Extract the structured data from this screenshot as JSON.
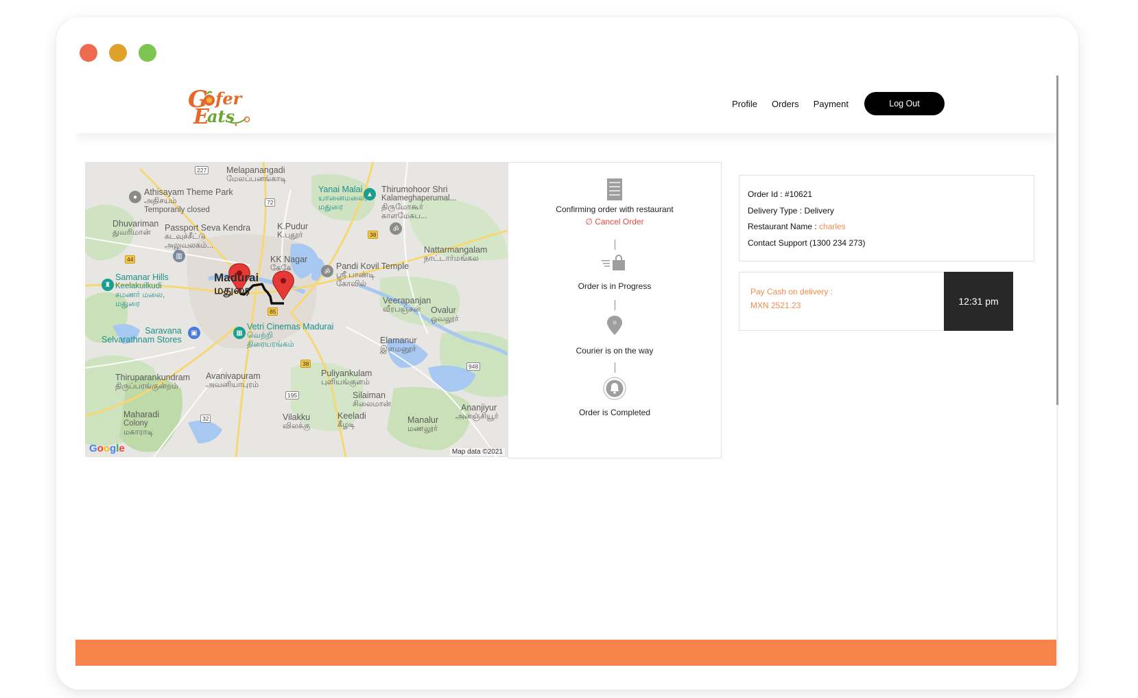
{
  "window": {
    "controls": [
      {
        "name": "close",
        "color": "#ee6a50"
      },
      {
        "name": "minimize",
        "color": "#e0a12a"
      },
      {
        "name": "maximize",
        "color": "#7dc453"
      }
    ]
  },
  "brand": {
    "logo_line1": "Gofer",
    "logo_line2": "Eats",
    "accent_color": "#f5834a",
    "logo_orange": "#e5682a",
    "logo_green": "#6aa632"
  },
  "nav": {
    "links": [
      "Profile",
      "Orders",
      "Payment"
    ],
    "logout_label": "Log Out"
  },
  "map": {
    "labels": {
      "melapanangadi": "Melapanangadi",
      "melapanangadi_ta": "மேலப்பனங்காடி",
      "athisayam": "Athisayam Theme Park",
      "athisayam_ta": "அதிசயம்",
      "athisayam_note": "Temporarily closed",
      "yanai_malai": "Yanai Malai",
      "yanai_malai_ta": "யானைமலை,",
      "yanai_malai_ta2": "மதுரை",
      "thirumohoor": "Thirumohoor Shri",
      "thirumohoor2": "Kalameghaperumal...",
      "thirumohoor_ta": "திருமோகூர்",
      "thirumohoor_ta2": "காளமேகப...",
      "dhuvariman": "Dhuvariman",
      "dhuvariman_ta": "துவரிமான்",
      "passport": "Passport Seva Kendra",
      "passport_ta": "கடவுச்சீட்டு",
      "passport_ta2": "அலுவலகம்...",
      "kpudur": "K.Pudur",
      "kpudur_ta": "K.புதூர்",
      "kknagar": "KK Nagar",
      "kknagar_ta": "கேகே",
      "nattarmangalam": "Nattarmangalam",
      "nattarmangalam_ta": "நாட்டார்மங்கல",
      "samanar": "Samanar Hills",
      "samanar2": "Keelakuilkudi",
      "samanar_ta": "சமணர் மலை,",
      "samanar_ta2": "மதுரை",
      "madurai": "Madurai",
      "madurai_ta": "மதுரை",
      "pandi": "Pandi Kovil Temple",
      "pandi_ta": "ஸ்ரீ பாண்டி",
      "pandi_ta2": "கோவில்",
      "veerapanjan": "Veerapanjan",
      "veerapanjan_ta": "வீரபஞ்சன்",
      "ovalur": "Ovalur",
      "ovalur_ta": "ஒவலூர்",
      "saravana": "Saravana",
      "saravana2": "Selvarathnam Stores",
      "vetri": "Vetri Cinemas Madurai",
      "vetri_ta": "வெற்றி",
      "vetri_ta2": "திரையரங்கம்",
      "elamanur": "Elamanur",
      "elamanur_ta": "இளமனூர்",
      "thiruparankundram": "Thiruparankundram",
      "thiruparankundram_ta": "திருப்பரங்குன்றம்",
      "avanivapuram": "Avanivapuram",
      "avanivapuram_ta": "அவனியாபுரம்",
      "puliyankulam": "Puliyankulam",
      "puliyankulam_ta": "புளியங்குளம்",
      "silaiman": "Silaiman",
      "silaiman_ta": "சிலைமான்",
      "maharadi": "Maharadi",
      "maharadi2": "Colony",
      "maharadi_ta": "மகாராடி",
      "vilakku": "Vilakku",
      "vilakku_ta": "விலக்கு",
      "keeladi": "Keeladi",
      "keeladi_ta": "கீழடி",
      "anjanjivur": "Ananjiyur",
      "anjanjivur_ta": "அனஞ்சியூர்",
      "manalur": "Manalur",
      "manalur_ta": "மணலூர்"
    },
    "shields": {
      "r227": "227",
      "r72": "72",
      "r38a": "38",
      "r44": "44",
      "r85": "85",
      "r38b": "38",
      "r948": "948",
      "r195": "195",
      "r32": "32"
    },
    "google_label": "Google",
    "attribution": "Map data ©2021"
  },
  "tracker": {
    "steps": [
      {
        "label": "Confirming order with restaurant",
        "icon": "receipt-icon"
      },
      {
        "label": "Order is in Progress",
        "icon": "shopping-bag-icon"
      },
      {
        "label": "Courier is on the way",
        "icon": "map-pin-icon"
      },
      {
        "label": "Order is Completed",
        "icon": "bell-icon"
      }
    ],
    "cancel_label": "Cancel Order"
  },
  "order": {
    "id_label": "Order Id : ",
    "id_value": "#10621",
    "delivery_label": "Delivery Type : ",
    "delivery_value": "Delivery",
    "restaurant_label": "Restaurant Name : ",
    "restaurant_value": "charles",
    "support_label": "Contact Support",
    "support_value": "(1300 234 273)"
  },
  "payment": {
    "method_label": "Pay Cash on delivery :",
    "amount": "MXN 2521.23",
    "time": "12:31 pm"
  }
}
